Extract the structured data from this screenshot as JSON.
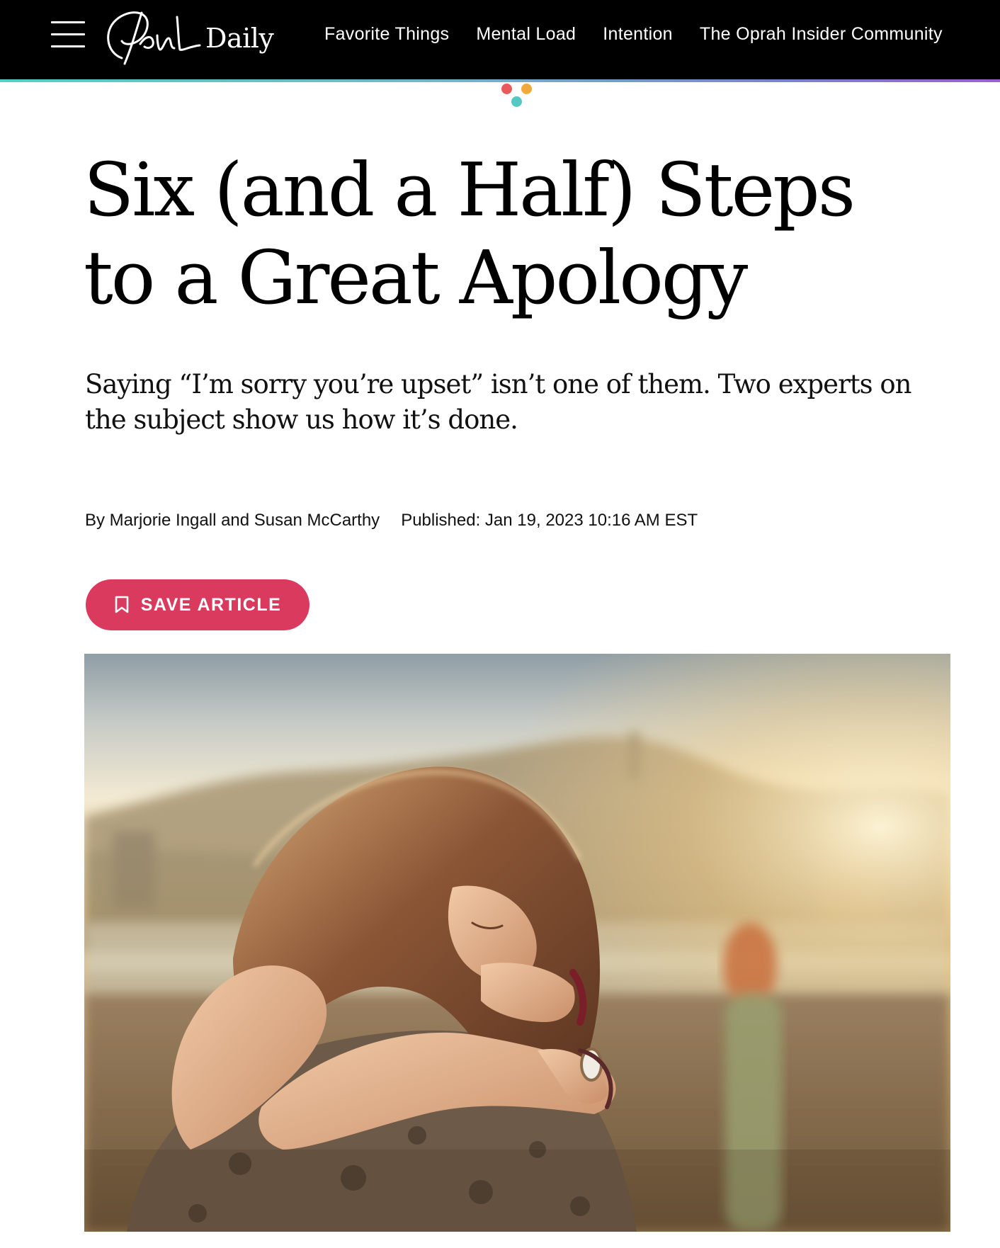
{
  "header": {
    "logo_text": "Oprah Daily",
    "logo_script": "Oprah",
    "logo_word": "Daily",
    "nav": [
      "Favorite Things",
      "Mental Load",
      "Intention",
      "The Oprah Insider Community"
    ]
  },
  "article": {
    "headline_line1": "Six (and a Half) Steps",
    "headline_line2": "to a Great Apology",
    "dek_line1": "Saying “I’m sorry you’re upset” isn’t one of them. Two experts on",
    "dek_line2": "the subject show us how it’s done.",
    "byline": "By Marjorie Ingall and Susan McCarthy",
    "published": "Published: Jan 19, 2023 10:16 AM EST",
    "save_label": "SAVE ARTICLE"
  },
  "icons": {
    "menu": "hamburger-icon",
    "save": "bookmark-icon"
  },
  "colors": {
    "header_bg": "#000000",
    "accent": "#d93a5e",
    "dot_red": "#e95a5a",
    "dot_orange": "#f2a93b",
    "dot_teal": "#56c8c4"
  }
}
